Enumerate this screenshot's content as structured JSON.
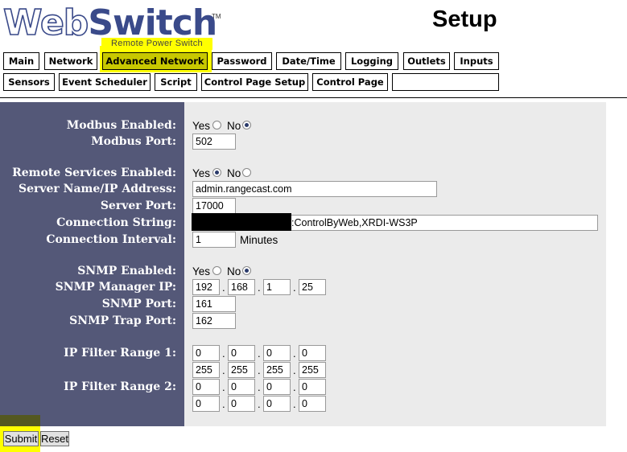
{
  "header": {
    "logo_web": "Web",
    "logo_switch": "Switch",
    "logo_tm": "TM",
    "logo_subtitle": "Remote Power Switch",
    "page_title": "Setup"
  },
  "nav": {
    "row1": [
      "Main",
      "Network",
      "Advanced Network",
      "Password",
      "Date/Time",
      "Logging",
      "Outlets",
      "Inputs"
    ],
    "row2": [
      "Sensors",
      "Event Scheduler",
      "Script",
      "Control Page Setup",
      "Control Page",
      ""
    ],
    "active": "Advanced Network"
  },
  "form": {
    "modbus_enabled_label": "Modbus Enabled:",
    "modbus_port_label": "Modbus Port:",
    "modbus_port": "502",
    "remote_enabled_label": "Remote Services Enabled:",
    "server_name_label": "Server Name/IP Address:",
    "server_name": "admin.rangecast.com",
    "server_port_label": "Server Port:",
    "server_port": "17000",
    "conn_string_label": "Connection String:",
    "conn_string": ":ControlByWeb,XRDI-WS3P",
    "conn_interval_label": "Connection Interval:",
    "conn_interval": "1",
    "minutes": "Minutes",
    "snmp_enabled_label": "SNMP Enabled:",
    "snmp_manager_label": "SNMP Manager IP:",
    "snmp_manager": [
      "192",
      "168",
      "1",
      "25"
    ],
    "snmp_port_label": "SNMP Port:",
    "snmp_port": "161",
    "snmp_trap_label": "SNMP Trap Port:",
    "snmp_trap": "162",
    "ip_filter1_label": "IP Filter Range 1:",
    "ip_filter1_start": [
      "0",
      "0",
      "0",
      "0"
    ],
    "ip_filter1_end": [
      "255",
      "255",
      "255",
      "255"
    ],
    "ip_filter2_label": "IP Filter Range 2:",
    "ip_filter2_start": [
      "0",
      "0",
      "0",
      "0"
    ],
    "ip_filter2_end": [
      "0",
      "0",
      "0",
      "0"
    ],
    "yes": "Yes",
    "no": "No",
    "modbus_enabled": "No",
    "remote_enabled": "Yes",
    "snmp_enabled": "No"
  },
  "buttons": {
    "submit": "Submit",
    "reset": "Reset"
  },
  "colors": {
    "label_panel": "#545878",
    "field_panel": "#ebebeb",
    "active_tab": "#c8c800",
    "highlight": "#ffff00"
  }
}
